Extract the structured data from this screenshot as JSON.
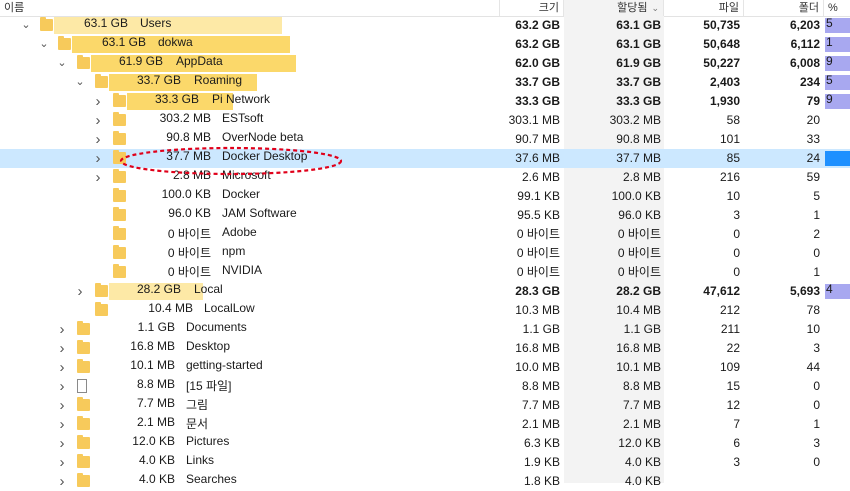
{
  "columns": {
    "name": "이름",
    "size": "크기",
    "allocated": "할당됨",
    "files": "파일",
    "folders": "폴더",
    "percent": "%"
  },
  "rows": [
    {
      "tree_size": "63.1 GB",
      "name": "Users",
      "size": "63.2 GB",
      "allocated": "63.1 GB",
      "files": "50,735",
      "folders": "6,203",
      "pct_fill": 1.0,
      "pct_label": "5"
    },
    {
      "tree_size": "63.1 GB",
      "name": "dokwa",
      "size": "63.2 GB",
      "allocated": "63.1 GB",
      "files": "50,648",
      "folders": "6,112",
      "pct_fill": 1.0,
      "pct_label": "1"
    },
    {
      "tree_size": "61.9 GB",
      "name": "AppData",
      "size": "62.0 GB",
      "allocated": "61.9 GB",
      "files": "50,227",
      "folders": "6,008",
      "pct_fill": 1.0,
      "pct_label": "9"
    },
    {
      "tree_size": "33.7 GB",
      "name": "Roaming",
      "size": "33.7 GB",
      "allocated": "33.7 GB",
      "files": "2,403",
      "folders": "234",
      "pct_fill": 1.0,
      "pct_label": "5"
    },
    {
      "tree_size": "33.3 GB",
      "name": "Pi Network",
      "size": "33.3 GB",
      "allocated": "33.3 GB",
      "files": "1,930",
      "folders": "79",
      "pct_fill": 1.0,
      "pct_label": "9"
    },
    {
      "tree_size": "303.2 MB",
      "name": "ESTsoft",
      "size": "303.1 MB",
      "allocated": "303.2 MB",
      "files": "58",
      "folders": "20",
      "pct_fill": 0.0,
      "pct_label": ""
    },
    {
      "tree_size": "90.8 MB",
      "name": "OverNode beta",
      "size": "90.7 MB",
      "allocated": "90.8 MB",
      "files": "101",
      "folders": "33",
      "pct_fill": 0.0,
      "pct_label": ""
    },
    {
      "tree_size": "37.7 MB",
      "name": "Docker Desktop",
      "size": "37.6 MB",
      "allocated": "37.7 MB",
      "files": "85",
      "folders": "24",
      "pct_fill": 1.0,
      "pct_label": ""
    },
    {
      "tree_size": "2.8 MB",
      "name": "Microsoft",
      "size": "2.6 MB",
      "allocated": "2.8 MB",
      "files": "216",
      "folders": "59",
      "pct_fill": 0.0,
      "pct_label": ""
    },
    {
      "tree_size": "100.0 KB",
      "name": "Docker",
      "size": "99.1 KB",
      "allocated": "100.0 KB",
      "files": "10",
      "folders": "5",
      "pct_fill": 0.0,
      "pct_label": ""
    },
    {
      "tree_size": "96.0 KB",
      "name": "JAM Software",
      "size": "95.5 KB",
      "allocated": "96.0 KB",
      "files": "3",
      "folders": "1",
      "pct_fill": 0.0,
      "pct_label": ""
    },
    {
      "tree_size": "0 바이트",
      "name": "Adobe",
      "size": "0 바이트",
      "allocated": "0 바이트",
      "files": "0",
      "folders": "2",
      "pct_fill": 0.0,
      "pct_label": ""
    },
    {
      "tree_size": "0 바이트",
      "name": "npm",
      "size": "0 바이트",
      "allocated": "0 바이트",
      "files": "0",
      "folders": "0",
      "pct_fill": 0.0,
      "pct_label": ""
    },
    {
      "tree_size": "0 바이트",
      "name": "NVIDIA",
      "size": "0 바이트",
      "allocated": "0 바이트",
      "files": "0",
      "folders": "1",
      "pct_fill": 0.0,
      "pct_label": ""
    },
    {
      "tree_size": "28.2 GB",
      "name": "Local",
      "size": "28.3 GB",
      "allocated": "28.2 GB",
      "files": "47,612",
      "folders": "5,693",
      "pct_fill": 1.0,
      "pct_label": "4"
    },
    {
      "tree_size": "10.4 MB",
      "name": "LocalLow",
      "size": "10.3 MB",
      "allocated": "10.4 MB",
      "files": "212",
      "folders": "78",
      "pct_fill": 0.0,
      "pct_label": ""
    },
    {
      "tree_size": "1.1 GB",
      "name": "Documents",
      "size": "1.1 GB",
      "allocated": "1.1 GB",
      "files": "211",
      "folders": "10",
      "pct_fill": 0.0,
      "pct_label": ""
    },
    {
      "tree_size": "16.8 MB",
      "name": "Desktop",
      "size": "16.8 MB",
      "allocated": "16.8 MB",
      "files": "22",
      "folders": "3",
      "pct_fill": 0.0,
      "pct_label": ""
    },
    {
      "tree_size": "10.1 MB",
      "name": "getting-started",
      "size": "10.0 MB",
      "allocated": "10.1 MB",
      "files": "109",
      "folders": "44",
      "pct_fill": 0.0,
      "pct_label": ""
    },
    {
      "tree_size": "8.8 MB",
      "name": "[15 파일]",
      "size": "8.8 MB",
      "allocated": "8.8 MB",
      "files": "15",
      "folders": "0",
      "pct_fill": 0.0,
      "pct_label": ""
    },
    {
      "tree_size": "7.7 MB",
      "name": "그림",
      "size": "7.7 MB",
      "allocated": "7.7 MB",
      "files": "12",
      "folders": "0",
      "pct_fill": 0.0,
      "pct_label": ""
    },
    {
      "tree_size": "2.1 MB",
      "name": "문서",
      "size": "2.1 MB",
      "allocated": "2.1 MB",
      "files": "7",
      "folders": "1",
      "pct_fill": 0.0,
      "pct_label": ""
    },
    {
      "tree_size": "12.0 KB",
      "name": "Pictures",
      "size": "6.3 KB",
      "allocated": "12.0 KB",
      "files": "6",
      "folders": "3",
      "pct_fill": 0.0,
      "pct_label": ""
    },
    {
      "tree_size": "4.0 KB",
      "name": "Links",
      "size": "1.9 KB",
      "allocated": "4.0 KB",
      "files": "3",
      "folders": "0",
      "pct_fill": 0.0,
      "pct_label": ""
    },
    {
      "tree_size": "4.0 KB",
      "name": "Searches",
      "size": "1.8 KB",
      "allocated": "4.0 KB",
      "files": "",
      "folders": "",
      "pct_fill": 0.0,
      "pct_label": ""
    }
  ],
  "colors": {
    "selected_row": "#cce8ff",
    "size_bar": "#fde9a6",
    "size_bar_strong": "#fbd86a",
    "folder": "#f7ca5b",
    "percent_bar": "#a8a8f0",
    "percent_bar_selected": "#1e90ff",
    "annotation": "#e0001a"
  }
}
